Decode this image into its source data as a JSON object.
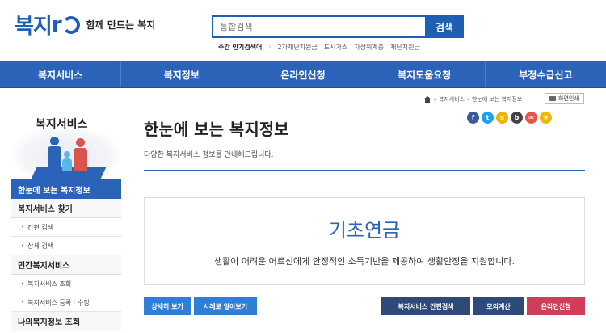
{
  "header": {
    "logo_mark": "복지",
    "logo_r": "r",
    "logo_tagline": "함께 만드는 복지",
    "search": {
      "placeholder": "통합검색",
      "button_label": "검색"
    },
    "popular": {
      "label": "주간 인기검색어",
      "keywords": [
        "2차재난지원금",
        "도시가스",
        "차상위계층",
        "재난지원금"
      ]
    }
  },
  "nav": {
    "items": [
      "복지서비스",
      "복지정보",
      "온라인신청",
      "복지도움요청",
      "부정수급신고"
    ]
  },
  "breadcrumb": {
    "items": [
      "복지서비스",
      "한눈에 보는 복지정보"
    ],
    "print_label": "화면인쇄"
  },
  "social": {
    "icons": [
      {
        "name": "facebook",
        "glyph": "f",
        "color": "#3b5998"
      },
      {
        "name": "twitter",
        "glyph": "t",
        "color": "#1da1f2"
      },
      {
        "name": "kakaostory",
        "glyph": "s",
        "color": "#f0b400"
      },
      {
        "name": "band",
        "glyph": "b",
        "color": "#444444"
      },
      {
        "name": "email",
        "glyph": "✉",
        "color": "#e8534b"
      },
      {
        "name": "bookmark",
        "glyph": "★",
        "color": "#f2b705"
      }
    ]
  },
  "sidebar": {
    "title": "복지서비스",
    "active_item": "한눈에 보는 복지정보",
    "groups": [
      {
        "label": "복지서비스 찾기",
        "items": [
          "간편 검색",
          "상세 검색"
        ]
      },
      {
        "label": "민간복지서비스",
        "items": [
          "복지서비스 조회",
          "복지서비스 등록 · 수정"
        ]
      },
      {
        "label": "나의복지정보 조회",
        "items": []
      }
    ]
  },
  "main": {
    "title": "한눈에 보는 복지정보",
    "description": "다양한 복지서비스 정보를 안내해드립니다.",
    "info": {
      "title": "기초연금",
      "description": "생활이 어려운 어르신에게 안정적인 소득기반을 제공하여 생활안정을 지원합니다."
    },
    "buttons": {
      "detail": "상세히 보기",
      "example": "사례로 알아보기",
      "simple_search": "복지서비스 간편검색",
      "mock_calc": "모의계산",
      "apply": "온라인신청"
    }
  },
  "colors": {
    "primary": "#2a63b8",
    "accent_red": "#d03d57",
    "navy": "#2d4a78"
  }
}
